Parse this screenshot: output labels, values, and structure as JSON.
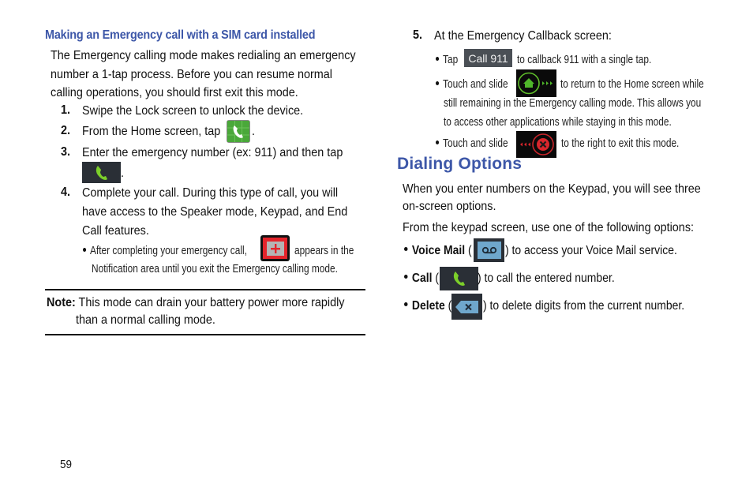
{
  "left": {
    "subheading": "Making an Emergency call with a SIM card installed",
    "intro": [
      "The Emergency calling mode makes redialing an emergency",
      "number a 1-tap process. Before you can resume normal",
      "calling operations, you should first exit this mode."
    ],
    "steps": [
      {
        "num": "1.",
        "text": "Swipe the Lock screen to unlock the device."
      },
      {
        "num": "2.",
        "text_before": "From the Home screen, tap",
        "text_after": ".",
        "icon": "phone-app-icon"
      },
      {
        "num": "3.",
        "text": "Enter the emergency number (ex: 911) and then tap",
        "text_after": ".",
        "icon": "call-button-icon"
      },
      {
        "num": "4.",
        "lines": [
          "Complete your call. During this type of call, you will",
          "have access to the Speaker mode, Keypad, and End",
          "Call features."
        ],
        "bullet_before": "After completing your emergency call,",
        "bullet_after": "appears in the",
        "bullet_line2": "Notification area until you exit the Emergency calling mode.",
        "bullet_icon": "emergency-notification-icon"
      }
    ],
    "note": {
      "label": "Note:",
      "line1": "This mode can drain your battery power more rapidly",
      "line2": "than a normal calling mode."
    }
  },
  "right": {
    "step5": {
      "num": "5.",
      "text": "At the Emergency Callback screen:",
      "bullets": [
        {
          "before": "Tap",
          "button_label": "Call 911",
          "after": "to callback 911 with a single tap."
        },
        {
          "before": "Touch and slide",
          "after": "to return to the Home screen while",
          "line2": "still remaining in the Emergency calling mode. This allows you",
          "line3": "to access other applications while staying in this mode.",
          "icon": "home-slider-icon"
        },
        {
          "before": "Touch and slide",
          "after": "to the right to exit this mode.",
          "icon": "exit-slider-icon"
        }
      ]
    },
    "heading": "Dialing Options",
    "para1_line1": "When you enter numbers on the Keypad, you will see three",
    "para1_line2": "on-screen options.",
    "para2": "From the keypad screen, use one of the following options:",
    "options": [
      {
        "label": "Voice Mail",
        "open": " (",
        "close": ") to access your Voice Mail service.",
        "icon": "voicemail-icon"
      },
      {
        "label": "Call",
        "open": " (",
        "close": ") to call the entered number.",
        "icon": "call-icon"
      },
      {
        "label": "Delete",
        "open": " (",
        "close": ") to delete digits from the current number.",
        "icon": "delete-icon"
      }
    ]
  },
  "footer": {
    "page_number": "59"
  },
  "colors": {
    "heading_blue": "#3d57a8",
    "icon_dark": "#2a2f36",
    "phone_green": "#7ccf2a",
    "alert_red": "#e0202a"
  }
}
